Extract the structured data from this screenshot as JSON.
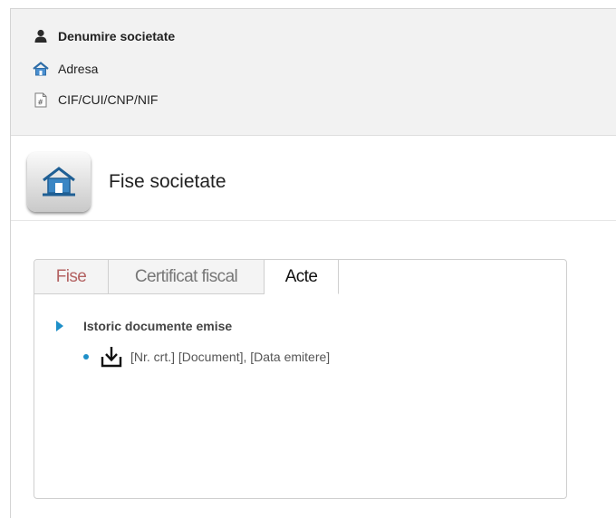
{
  "company": {
    "name": "Denumire societate",
    "address": "Adresa",
    "fiscal_code": "CIF/CUI/CNP/NIF"
  },
  "page": {
    "title": "Fise societate"
  },
  "tabs": [
    {
      "label": "Fise"
    },
    {
      "label": "Certificat fiscal"
    },
    {
      "label": "Acte",
      "active": true
    }
  ],
  "tree": {
    "heading": "Istoric documente emise",
    "items": [
      {
        "text": "[Nr. crt.] [Document], [Data emitere]"
      }
    ]
  },
  "colors": {
    "accent": "#1e8fc8",
    "tab_inactive_text": "#b46363"
  },
  "icons": {
    "name": "person-icon",
    "address": "house-icon",
    "fiscal_code": "document-hash-icon",
    "logo": "company-house-icon",
    "download": "download-icon"
  }
}
